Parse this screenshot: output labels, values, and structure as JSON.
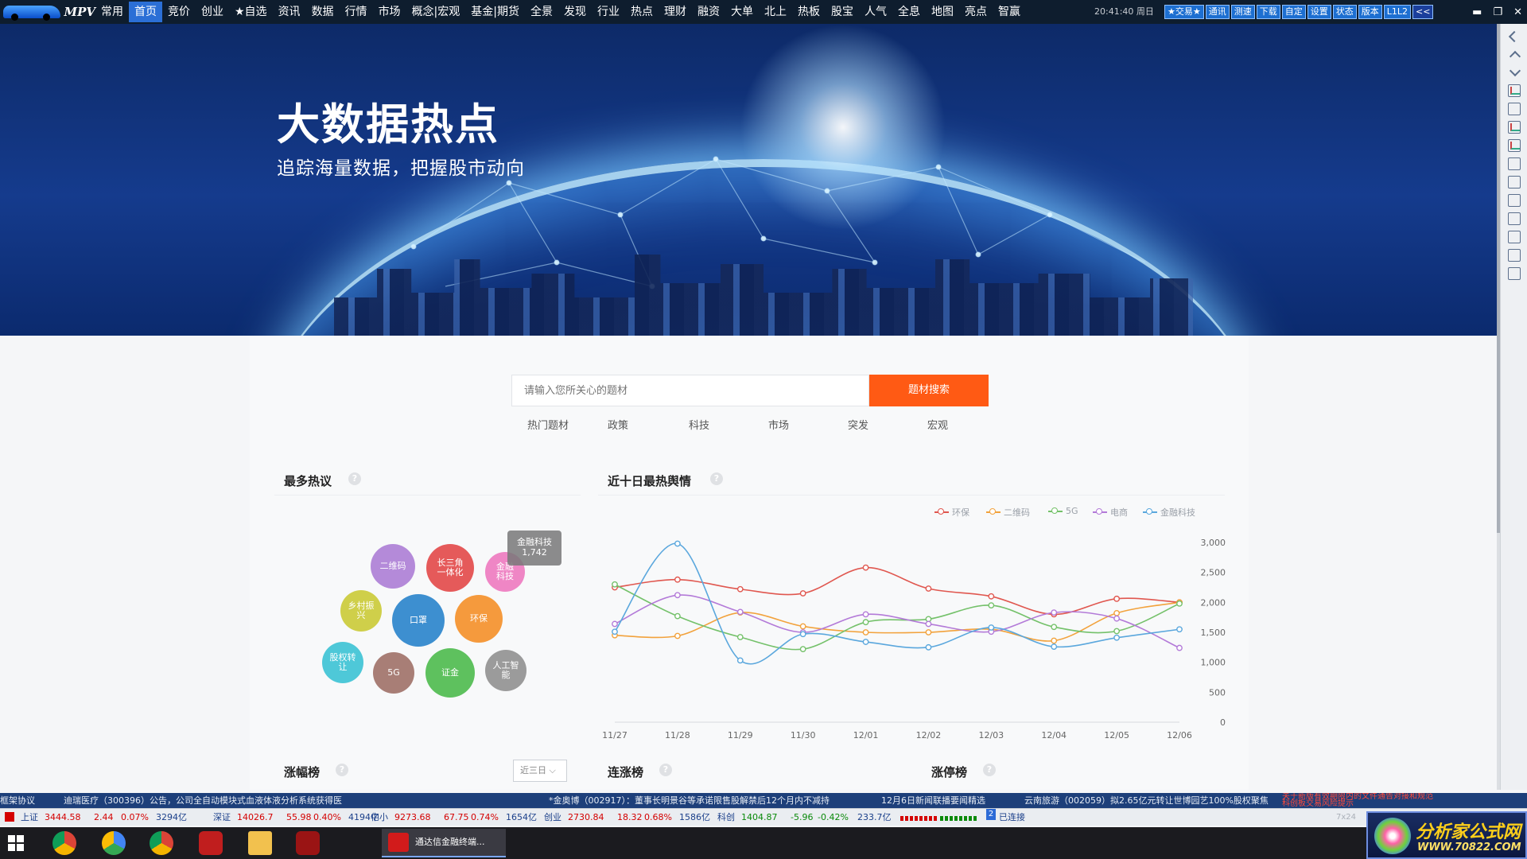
{
  "app": {
    "logo_text": "MPV",
    "menu": [
      "常用",
      "首页",
      "竞价",
      "创业",
      "★自选",
      "资讯",
      "数据",
      "行情",
      "市场",
      "概念|宏观",
      "基金|期货",
      "全景",
      "发现",
      "行业",
      "热点",
      "理财",
      "融资",
      "大单",
      "北上",
      "热板",
      "股宝",
      "人气",
      "全息",
      "地图",
      "亮点",
      "智赢"
    ],
    "active_menu": "首页",
    "clock": "20:41:40 周日",
    "tool_buttons": [
      "★交易★",
      "通讯",
      "测速",
      "下载",
      "自定",
      "设置",
      "状态",
      "版本",
      "L1L2",
      "<<"
    ],
    "window_controls": [
      "▬",
      "❐",
      "✕"
    ]
  },
  "banner": {
    "title": "大数据热点",
    "subtitle": "追踪海量数据，把握股市动向"
  },
  "search": {
    "placeholder": "请输入您所关心的题材",
    "button": "题材搜索",
    "tabs": [
      "热门题材",
      "政策",
      "科技",
      "市场",
      "突发",
      "宏观"
    ]
  },
  "hot_topics": {
    "title": "最多热议",
    "help": "?",
    "bubbles": [
      {
        "label": "二维码",
        "color": "#b48ad9"
      },
      {
        "label": "长三角一体化",
        "color": "#e55a5a"
      },
      {
        "label": "金融科技",
        "color": "#ef86c5"
      },
      {
        "label": "乡村振兴",
        "color": "#cfcf4a"
      },
      {
        "label": "口罩",
        "color": "#3d8fd0"
      },
      {
        "label": "环保",
        "color": "#f59a3d"
      },
      {
        "label": "股权转让",
        "color": "#4ec8d8"
      },
      {
        "label": "5G",
        "color": "#a87e76"
      },
      {
        "label": "证金",
        "color": "#5ec15e"
      },
      {
        "label": "人工智能",
        "color": "#9b9b9b"
      }
    ],
    "tooltip": {
      "name": "金融科技",
      "value": "1,742"
    }
  },
  "sentiment": {
    "title": "近十日最热舆情",
    "help": "?"
  },
  "chart_data": {
    "type": "line",
    "title": "近十日最热舆情",
    "x": [
      "11/27",
      "11/28",
      "11/29",
      "11/30",
      "12/01",
      "12/02",
      "12/03",
      "12/04",
      "12/05",
      "12/06"
    ],
    "ylim": [
      0,
      3000
    ],
    "yticks": [
      "0",
      "500",
      "1,000",
      "1,500",
      "2,000",
      "2,500",
      "3,000"
    ],
    "legend_position": "top-right",
    "series": [
      {
        "name": "环保",
        "color": "#e0574f",
        "values": [
          2250,
          2380,
          2220,
          2150,
          2580,
          2230,
          2100,
          1800,
          2060,
          2000
        ]
      },
      {
        "name": "二维码",
        "color": "#f2a23c",
        "values": [
          1450,
          1440,
          1830,
          1600,
          1500,
          1500,
          1550,
          1360,
          1820,
          2000
        ]
      },
      {
        "name": "5G",
        "color": "#74c16a",
        "values": [
          2300,
          1770,
          1420,
          1220,
          1670,
          1720,
          1950,
          1590,
          1520,
          1980
        ]
      },
      {
        "name": "电商",
        "color": "#b37ad8",
        "values": [
          1640,
          2120,
          1840,
          1500,
          1800,
          1640,
          1510,
          1830,
          1730,
          1240
        ]
      },
      {
        "name": "金融科技",
        "color": "#5aa7dd",
        "values": [
          1510,
          2980,
          1030,
          1470,
          1340,
          1250,
          1580,
          1260,
          1410,
          1550
        ]
      }
    ]
  },
  "lists": {
    "gainers": {
      "title": "涨幅榜",
      "help": "?",
      "range": "近三日"
    },
    "streak": {
      "title": "连涨榜",
      "help": "?"
    },
    "limit_up": {
      "title": "涨停榜",
      "help": "?"
    }
  },
  "news_ticker": [
    "框架协议",
    "迪瑞医疗（300396）公告，公司全自动模块式血液体液分析系统获得医",
    "*金奥博（002917）：董事长明景谷等承诺限售股解禁后12个月内不减持",
    "12月6日新闻联播要闻精选",
    "云南旅游（002059）拟2.65亿元转让世博园艺100%股权聚焦",
    "关于新版有效期限内的文件通告对接和规范",
    "科创板交易风险提示"
  ],
  "index_ticker": [
    {
      "name": "上证",
      "value": "3444.58",
      "change": "2.44",
      "pct": "0.07%",
      "vol": "3294亿"
    },
    {
      "name": "深证",
      "value": "14026.7",
      "change": "55.98",
      "pct": "0.40%",
      "vol": "4194亿"
    },
    {
      "name": "中小",
      "value": "9273.68",
      "change": "67.75",
      "pct": "0.74%",
      "vol": "1654亿"
    },
    {
      "name": "创业",
      "value": "2730.84",
      "change": "18.32",
      "pct": "0.68%",
      "vol": "1586亿"
    },
    {
      "name": "科创",
      "value": "1404.87",
      "change": "-5.96",
      "pct": "-0.42%",
      "vol": "233.7亿"
    }
  ],
  "status": {
    "badge": "2",
    "connection": "已连接",
    "time_hint": "7x24"
  },
  "taskbar": {
    "active_task": "通达信金融终端..."
  },
  "watermark": {
    "line1": "分析家公式网",
    "line2": "WWW.70822.COM"
  }
}
